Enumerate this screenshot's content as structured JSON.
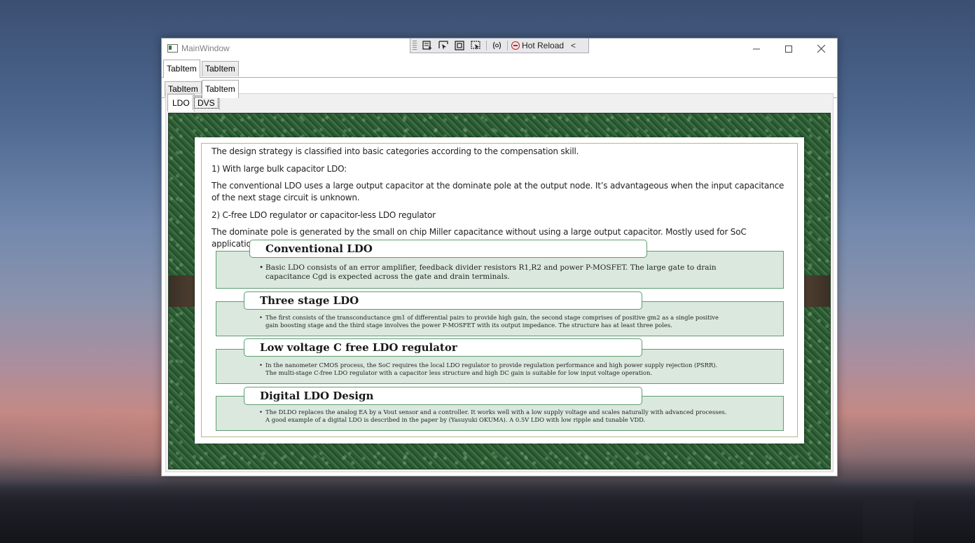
{
  "window": {
    "title": "MainWindow",
    "controls": {
      "minimize": "—",
      "maximize": "☐",
      "close": "✕"
    }
  },
  "hot_reload_toolbar": {
    "label": "Hot Reload",
    "chevron": "<",
    "icons": [
      "select-element-icon",
      "select-element-icon",
      "display-layout-icon",
      "track-focus-icon",
      "binding-failures-icon",
      "hot-reload-stop-icon"
    ],
    "binding_glyph": "(⊘)"
  },
  "outer_tabs": [
    "TabItem",
    "TabItem"
  ],
  "second_tabs": [
    "TabItem",
    "TabItem"
  ],
  "inner_tabs": [
    "LDO",
    "DVS"
  ],
  "slide": {
    "intro": "The design strategy is classified into basic categories according to the compensation skill.",
    "item1": "1)    With large bulk capacitor LDO:",
    "para1": "The conventional LDO uses a large output capacitor at the dominate pole at the output node. It’s advantageous when the input capacitance of the next stage circuit is unknown.",
    "item2": "2)    C-free LDO regulator or capacitor-less LDO regulator",
    "para2": "The dominate pole is generated by the small on chip Miller capacitance without using a large output capacitor. Mostly used for SoC applications.",
    "boxes": [
      {
        "title": "Conventional LDO",
        "body": "Basic LDO consists of an error amplifier, feedback divider resistors R1,R2 and power P-MOSFET.  The large gate to drain capacitance Cgd is expected across the gate and drain terminals."
      },
      {
        "title": "Three stage LDO",
        "body": "The first consists of the transconductance gm1 of differential pairs to provide high gain, the second stage comprises of positive gm2 as a single positive gain boosting stage and the third stage involves the power P-MOSFET with its output impedance.  The structure has at least three poles."
      },
      {
        "title": "Low voltage C free LDO regulator",
        "body": "In the nanometer CMOS process, the SoC requires the local LDO regulator to provide regulation performance and high power supply rejection (PSRR). The multi-stage C-free LDO regulator with a capacitor less structure and high DC gain is suitable for low input voltage operation."
      },
      {
        "title": "Digital LDO Design",
        "body": "The DLDO replaces the analog EA by a Vout sensor and a controller. It works well with a low supply voltage and scales naturally with advanced processes. A good example of  a digital LDO is described in the paper by (Yasuyuki OKUMA).  A 0.5V LDO with low ripple and tunable VDD."
      }
    ]
  }
}
